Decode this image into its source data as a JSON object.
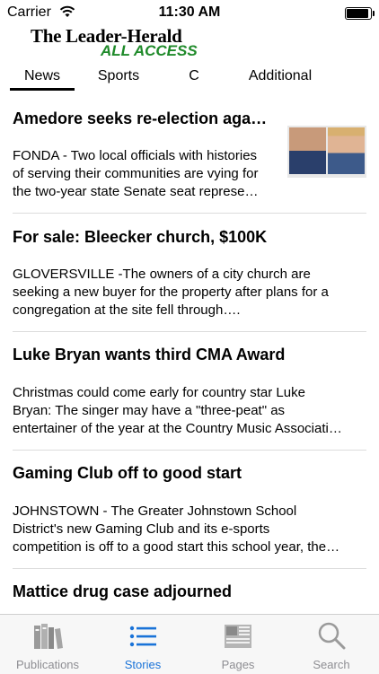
{
  "status_bar": {
    "carrier": "Carrier",
    "time": "11:30 AM"
  },
  "header": {
    "logo_line1": "The Leader-Herald",
    "logo_line2": "ALL ACCESS"
  },
  "tabs": [
    {
      "label": "News",
      "selected": true
    },
    {
      "label": "Sports",
      "selected": false
    },
    {
      "label": "C",
      "selected": false
    },
    {
      "label": "Additional",
      "selected": false
    }
  ],
  "articles": [
    {
      "title": "Amedore seeks re-election aga…",
      "lines": [
        "FONDA - Two local officials with histories",
        "of serving their communities are vying for",
        "the two-year state Senate seat represe…"
      ],
      "has_thumbnail": true
    },
    {
      "title": "For sale: Bleecker church, $100K",
      "lines": [
        "GLOVERSVILLE -The owners of a city church are",
        "seeking a new buyer for the property after plans for a",
        "congregation at the site fell through…."
      ]
    },
    {
      "title": "Luke Bryan wants third CMA Award",
      "lines": [
        "Christmas could come early for country star Luke",
        "Bryan: The singer may have a \"three-peat\" as",
        "entertainer of the year at the Country Music Associati…"
      ]
    },
    {
      "title": "Gaming Club off to good start",
      "lines": [
        "JOHNSTOWN - The Greater Johnstown School",
        "District's new Gaming Club and its e-sports",
        "competition is off to a good start this school year, the…"
      ]
    },
    {
      "title": "Mattice drug case adjourned",
      "lines": []
    }
  ],
  "tab_bar": {
    "items": [
      {
        "label": "Publications",
        "icon": "books-icon",
        "active": false
      },
      {
        "label": "Stories",
        "icon": "list-icon",
        "active": true
      },
      {
        "label": "Pages",
        "icon": "pages-icon",
        "active": false
      },
      {
        "label": "Search",
        "icon": "search-icon",
        "active": false
      }
    ]
  },
  "colors": {
    "accent": "#1a73d8",
    "logo_green": "#1f8a2a",
    "inactive": "#8e8e93"
  }
}
